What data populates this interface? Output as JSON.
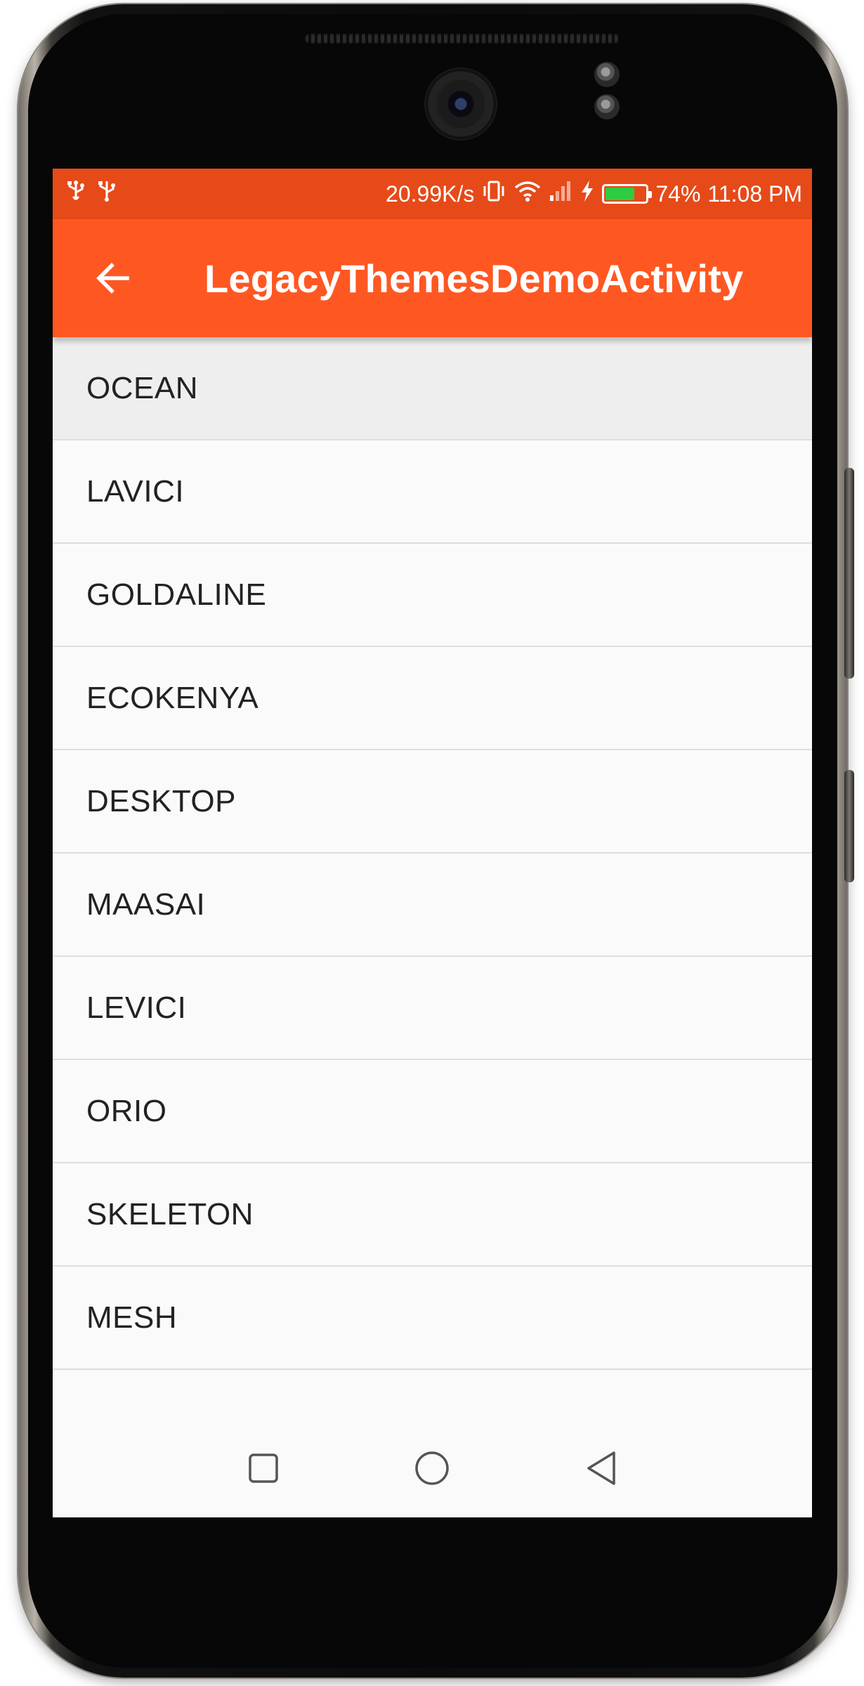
{
  "status_bar": {
    "left_icons": [
      "usb-icon",
      "usb-icon"
    ],
    "network_speed": "20.99K/s",
    "right_icons": [
      "vibrate-icon",
      "wifi-icon",
      "signal-icon",
      "charging-icon"
    ],
    "battery_percent": "74%",
    "battery_level": 0.74,
    "time": "11:08 PM"
  },
  "app_bar": {
    "back_icon": "arrow-back-icon",
    "title": "LegacyThemesDemoActivity"
  },
  "themes": [
    {
      "label": "OCEAN",
      "pressed": true
    },
    {
      "label": "LAVICI",
      "pressed": false
    },
    {
      "label": "GOLDALINE",
      "pressed": false
    },
    {
      "label": "ECOKENYA",
      "pressed": false
    },
    {
      "label": "DESKTOP",
      "pressed": false
    },
    {
      "label": "MAASAI",
      "pressed": false
    },
    {
      "label": "LEVICI",
      "pressed": false
    },
    {
      "label": "ORIO",
      "pressed": false
    },
    {
      "label": "SKELETON",
      "pressed": false
    },
    {
      "label": "MESH",
      "pressed": false
    }
  ],
  "nav_bar": {
    "buttons": [
      "recents-square-icon",
      "home-circle-icon",
      "back-triangle-icon"
    ]
  },
  "colors": {
    "status_bar": "#e64a19",
    "app_bar": "#ff5722",
    "list_background": "#fafafa",
    "pressed_item": "#eeeeee",
    "battery_fill": "#2ecc40"
  }
}
